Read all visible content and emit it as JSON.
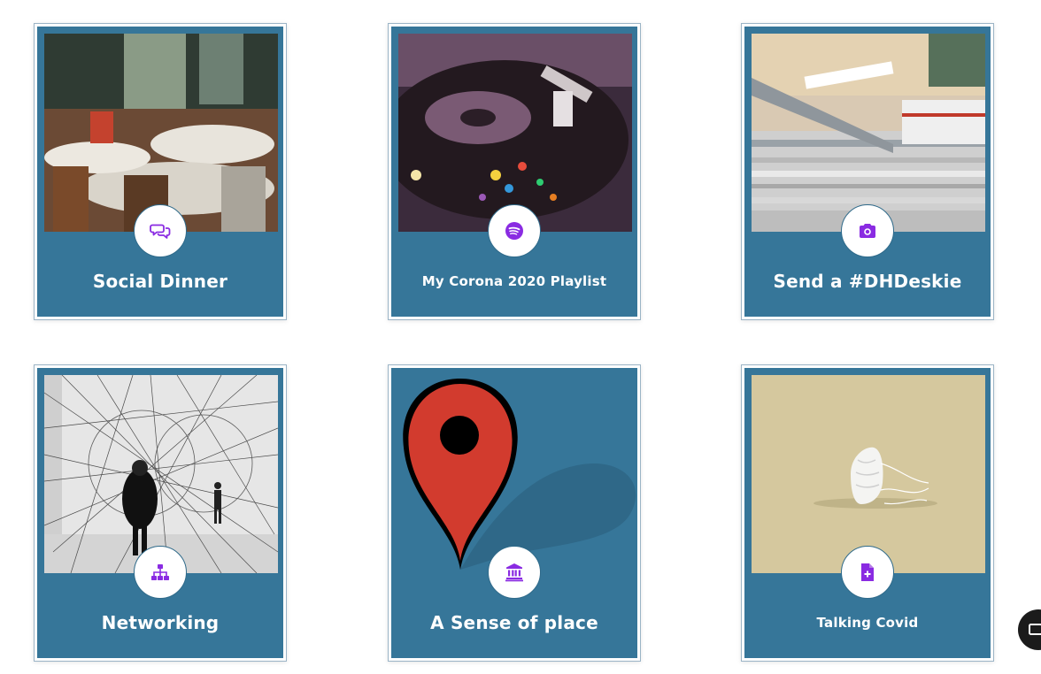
{
  "cards": [
    {
      "title": "Social Dinner",
      "icon": "comments-icon",
      "image": "restaurant dining room photo"
    },
    {
      "title": "My Corona 2020 Playlist",
      "icon": "spotify-icon",
      "image": "record player photo"
    },
    {
      "title": "Send a #DHDeskie",
      "icon": "camera-icon",
      "image": "stack of magazines and laptop photo"
    },
    {
      "title": "Networking",
      "icon": "sitemap-icon",
      "image": "string installation art photo"
    },
    {
      "title": "A Sense of place",
      "icon": "landmark-icon",
      "image": "map pin illustration"
    },
    {
      "title": "Talking Covid",
      "icon": "file-medical-icon",
      "image": "face mask illustration"
    }
  ],
  "colors": {
    "card_bg": "#367699",
    "icon_accent": "#8a2be2",
    "title_text": "#ffffff"
  },
  "chat_widget": {
    "icon": "chat-widget-icon"
  }
}
